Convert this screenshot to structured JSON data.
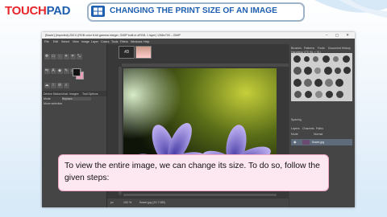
{
  "brand": {
    "part1": "TOUCH",
    "part2": "PAD"
  },
  "lesson_title": "CHANGING THE PRINT SIZE OF AN IMAGE",
  "colors": {
    "brand_red": "#e8262b",
    "brand_blue": "#1f5fb0",
    "caption_bg": "#fde7f0",
    "caption_border": "#f2a7c6"
  },
  "gimp": {
    "window_title": "[flower] (imported)-253.0 (RGB color 8-bit gamma integer, GIMP built-in sRGB, 1 layer) 1266x700 – GIMP",
    "window_buttons": "– ▢ ✕",
    "menus": [
      "File",
      "Edit",
      "Select",
      "View",
      "Image",
      "Layer",
      "Colors",
      "Tools",
      "Filters",
      "Windows",
      "Help"
    ],
    "image_tab_label": "#3",
    "left_tabs": [
      "Device Status",
      "Undo",
      "Images",
      "Tool Options"
    ],
    "tool_options": {
      "mode_label": "Mode",
      "mode_value": "Replace",
      "hint": "Move selection"
    },
    "right_tabs": [
      "Brushes",
      "Patterns",
      "Fonts",
      "Document History"
    ],
    "brush_name": "Hardness 075 (51 × 51)",
    "spacing_label": "Spacing",
    "layers_tabs": [
      "Layers",
      "Channels",
      "Paths"
    ],
    "layers_mode": "Mode",
    "layers_mode_value": "Normal",
    "layer_name": "flower.jpg",
    "status": {
      "unit": "px",
      "zoom": "100 %",
      "info": "flower.jpg (23.7 MB)"
    }
  },
  "caption": "To view the entire image, we can change its size. To do so, follow the given steps:"
}
